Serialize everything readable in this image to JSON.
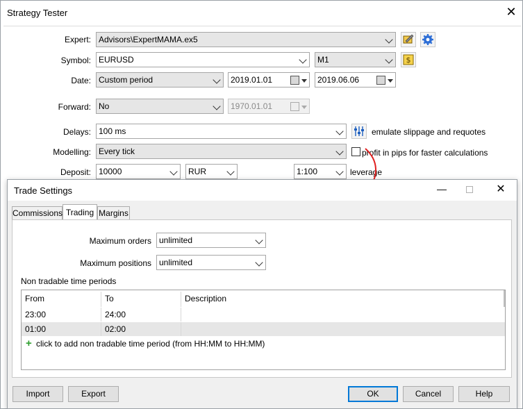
{
  "tester": {
    "title": "Strategy Tester",
    "expert": {
      "label": "Expert:",
      "value": "Advisors\\ExpertMAMA.ex5"
    },
    "symbol": {
      "label": "Symbol:",
      "value": "EURUSD",
      "timeframe": "M1"
    },
    "date": {
      "label": "Date:",
      "period": "Custom period",
      "from": "2019.01.01",
      "to": "2019.06.06"
    },
    "forward": {
      "label": "Forward:",
      "value": "No",
      "date": "1970.01.01"
    },
    "delays": {
      "label": "Delays:",
      "value": "100 ms",
      "option": "emulate slippage and requotes"
    },
    "modelling": {
      "label": "Modelling:",
      "value": "Every tick",
      "option": "profit in pips for faster calculations"
    },
    "deposit": {
      "label": "Deposit:",
      "amount": "10000",
      "currency": "RUR",
      "leverage_value": "1:100",
      "leverage_label": "leverage"
    }
  },
  "dialog": {
    "title": "Trade Settings",
    "tabs": [
      {
        "label": "Commissions"
      },
      {
        "label": "Trading"
      },
      {
        "label": "Margins"
      }
    ],
    "max_orders": {
      "label": "Maximum orders",
      "value": "unlimited"
    },
    "max_positions": {
      "label": "Maximum positions",
      "value": "unlimited"
    },
    "periods_title": "Non tradable time periods",
    "columns": {
      "from": "From",
      "to": "To",
      "description": "Description"
    },
    "rows": [
      {
        "from": "23:00",
        "to": "24:00",
        "description": ""
      },
      {
        "from": "01:00",
        "to": "02:00",
        "description": ""
      }
    ],
    "add_hint": "click to add non tradable time period (from HH:MM to HH:MM)",
    "buttons": {
      "import": "Import",
      "export": "Export",
      "ok": "OK",
      "cancel": "Cancel",
      "help": "Help"
    }
  },
  "colors": {
    "accent": "#0078d7",
    "arrow": "#e02020",
    "plus": "#2e9e2e",
    "selected_row": "#e6e6e6"
  }
}
